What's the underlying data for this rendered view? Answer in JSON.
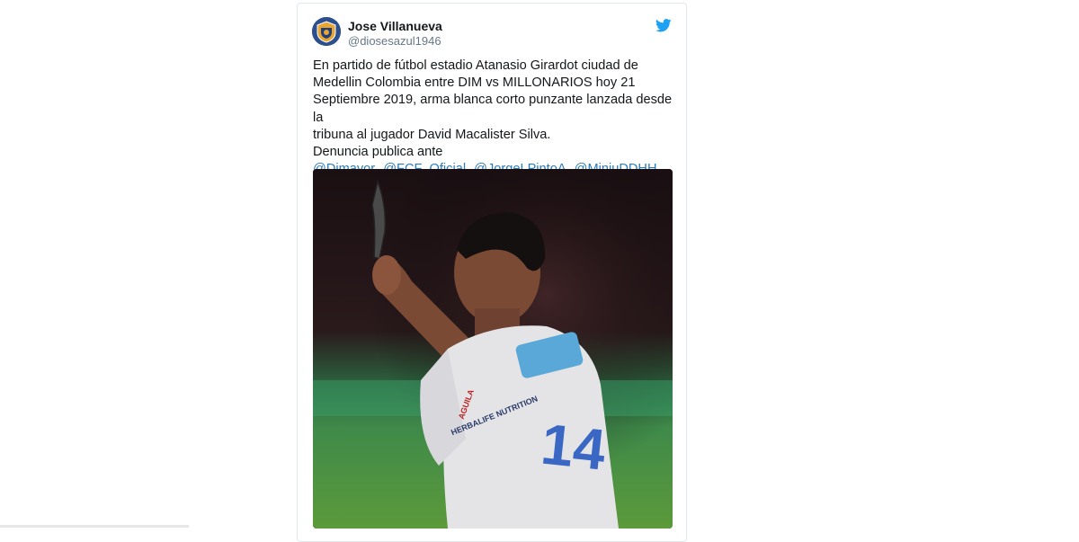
{
  "tweet": {
    "author_name": "Jose Villanueva",
    "author_handle": "@diosesazul1946",
    "text_lines": [
      "En partido de fútbol estadio Atanasio Girardot ciudad de",
      "Medellin Colombia entre DIM vs MILLONARIOS hoy 21",
      "Septiembre 2019, arma blanca corto punzante lanzada desde la",
      "tribuna al jugador David Macalister Silva.",
      "Denuncia publica ante"
    ],
    "mentions": [
      "@Dimayor",
      "@FCF_Oficial",
      "@JorgeLPintoA",
      "@MinjuDDHH"
    ],
    "photo": {
      "jersey_number": "14",
      "sponsor_text": "HERBALIFE NUTRITION",
      "badge_text": "AGUILA"
    }
  },
  "colors": {
    "link": "#2b7bb9",
    "twitter_blue": "#1da1f2",
    "text": "#14171a",
    "secondary": "#657786"
  },
  "icons": {
    "brand": "twitter-bird-icon"
  }
}
